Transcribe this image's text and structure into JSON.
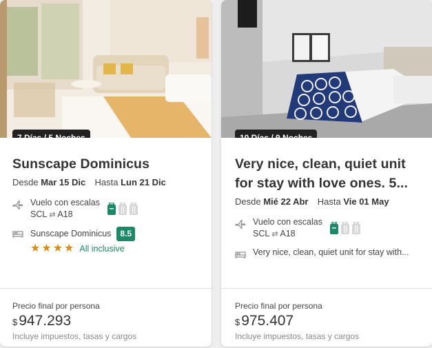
{
  "cards": [
    {
      "badge": "7 Días / 5 Noches",
      "title": "Sunscape Dominicus",
      "dates": {
        "from_label": "Desde",
        "from_value": "Mar 15 Dic",
        "to_label": "Hasta",
        "to_value": "Lun 21 Dic"
      },
      "flight": {
        "label": "Vuelo con escalas",
        "route_from": "SCL",
        "route_to": "A18",
        "icon": "plane-icon"
      },
      "hotel": {
        "name": "Sunscape Dominicus",
        "score": "8.5",
        "stars": 4,
        "star_symbol": "★",
        "board": "All inclusive",
        "icon": "bed-icon"
      },
      "footer": {
        "label": "Precio final por persona",
        "currency": "$",
        "price": "947.293",
        "note": "Incluye impuestos, tasas y cargos"
      }
    },
    {
      "badge": "10 Días / 9 Noches",
      "title_line1": "Very nice, clean, quiet unit",
      "title_line2": "for stay with love ones. 5...",
      "dates": {
        "from_label": "Desde",
        "from_value": "Mié 22 Abr",
        "to_label": "Hasta",
        "to_value": "Vie 01 May"
      },
      "flight": {
        "label": "Vuelo con escalas",
        "route_from": "SCL",
        "route_to": "A18",
        "icon": "plane-icon"
      },
      "hotel": {
        "name": "Very nice, clean, quiet unit for stay with...",
        "icon": "bed-icon"
      },
      "footer": {
        "label": "Precio final por persona",
        "currency": "$",
        "price": "975.407",
        "note": "Incluye impuestos, tasas y cargos"
      }
    }
  ],
  "colors": {
    "accent_green": "#1a8a66",
    "star": "#e08a13",
    "badge_bg": "#222222"
  }
}
